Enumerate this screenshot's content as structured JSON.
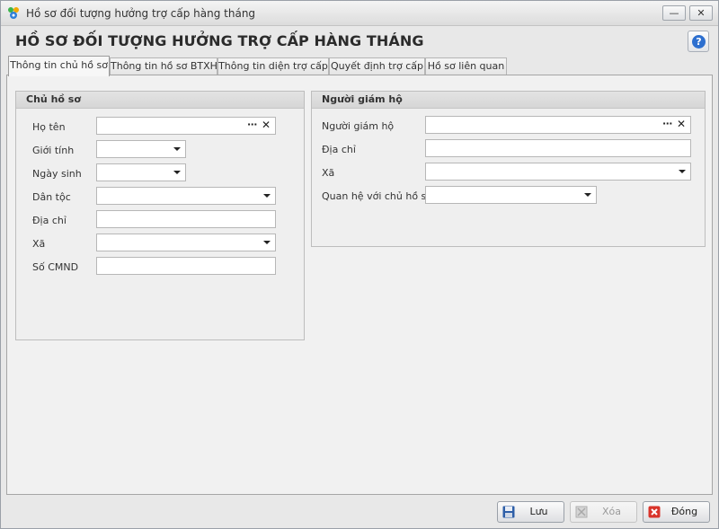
{
  "window": {
    "title": "Hồ sơ đối tượng hưởng trợ cấp hàng tháng",
    "minimize": "—",
    "close": "✕"
  },
  "header": {
    "heading": "HỒ SƠ ĐỐI TƯỢNG HƯỞNG TRỢ CẤP HÀNG THÁNG",
    "help": "?"
  },
  "tabs": [
    {
      "label": "Thông tin chủ hồ sơ"
    },
    {
      "label": "Thông tin hồ sơ BTXH"
    },
    {
      "label": "Thông tin diện trợ cấp"
    },
    {
      "label": "Quyết định trợ cấp"
    },
    {
      "label": "Hồ sơ liên quan"
    }
  ],
  "owner": {
    "title": "Chủ hồ sơ",
    "name_label": "Họ tên",
    "name_value": "",
    "name_dots": "···",
    "name_clear": "✕",
    "gender_label": "Giới tính",
    "gender_value": "",
    "dob_label": "Ngày sinh",
    "dob_value": "",
    "ethnic_label": "Dân tộc",
    "ethnic_value": "",
    "address_label": "Địa chỉ",
    "address_value": "",
    "commune_label": "Xã",
    "commune_value": "",
    "id_label": "Số CMND",
    "id_value": ""
  },
  "guardian": {
    "title": "Người giám hộ",
    "name_label": "Người giám hộ",
    "name_value": "",
    "name_dots": "···",
    "name_clear": "✕",
    "address_label": "Địa chỉ",
    "address_value": "",
    "commune_label": "Xã",
    "commune_value": "",
    "relation_label": "Quan hệ với chủ hồ sơ",
    "relation_value": ""
  },
  "footer": {
    "save": "Lưu",
    "delete": "Xóa",
    "close": "Đóng"
  }
}
